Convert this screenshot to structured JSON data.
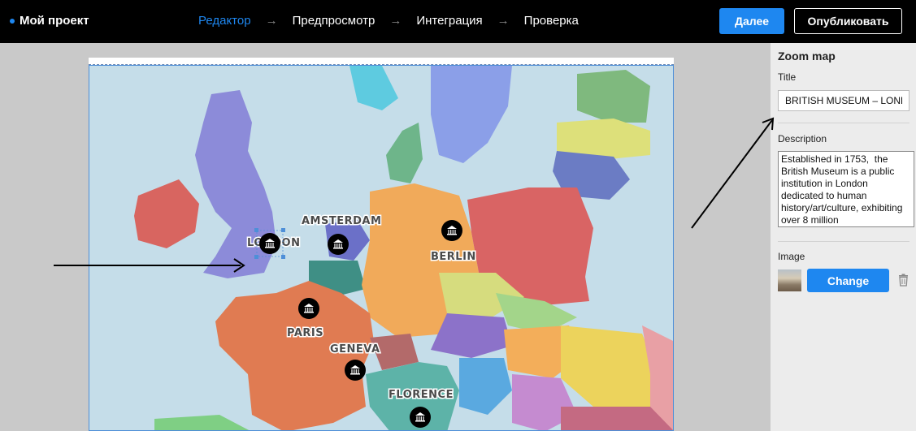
{
  "header": {
    "project_name": "Мой проект",
    "steps": [
      "Редактор",
      "Предпросмотр",
      "Интеграция",
      "Проверка"
    ],
    "active_step": "Редактор",
    "next_label": "Далее",
    "publish_label": "Опубликовать"
  },
  "map": {
    "cities": [
      "AMSTERDAM",
      "LONDON",
      "BERLIN",
      "PARIS",
      "GENEVA",
      "FLORENCE"
    ]
  },
  "panel": {
    "heading": "Zoom map",
    "title_label": "Title",
    "title_value": "BRITISH MUSEUM – LONDON",
    "description_label": "Description",
    "description_value": "Established in 1753,  the British Museum is a public institution in London dedicated to human history/art/culture, exhibiting over 8 million",
    "image_label": "Image",
    "change_label": "Change"
  },
  "colors": {
    "accent": "#1e87f0",
    "topbar": "#000000",
    "panel_bg": "#ececec",
    "canvas_bg": "#c9c9c9",
    "sea": "#c5dde9"
  },
  "icons": [
    "museum-icon",
    "trash-icon",
    "arrow-right-icon"
  ]
}
